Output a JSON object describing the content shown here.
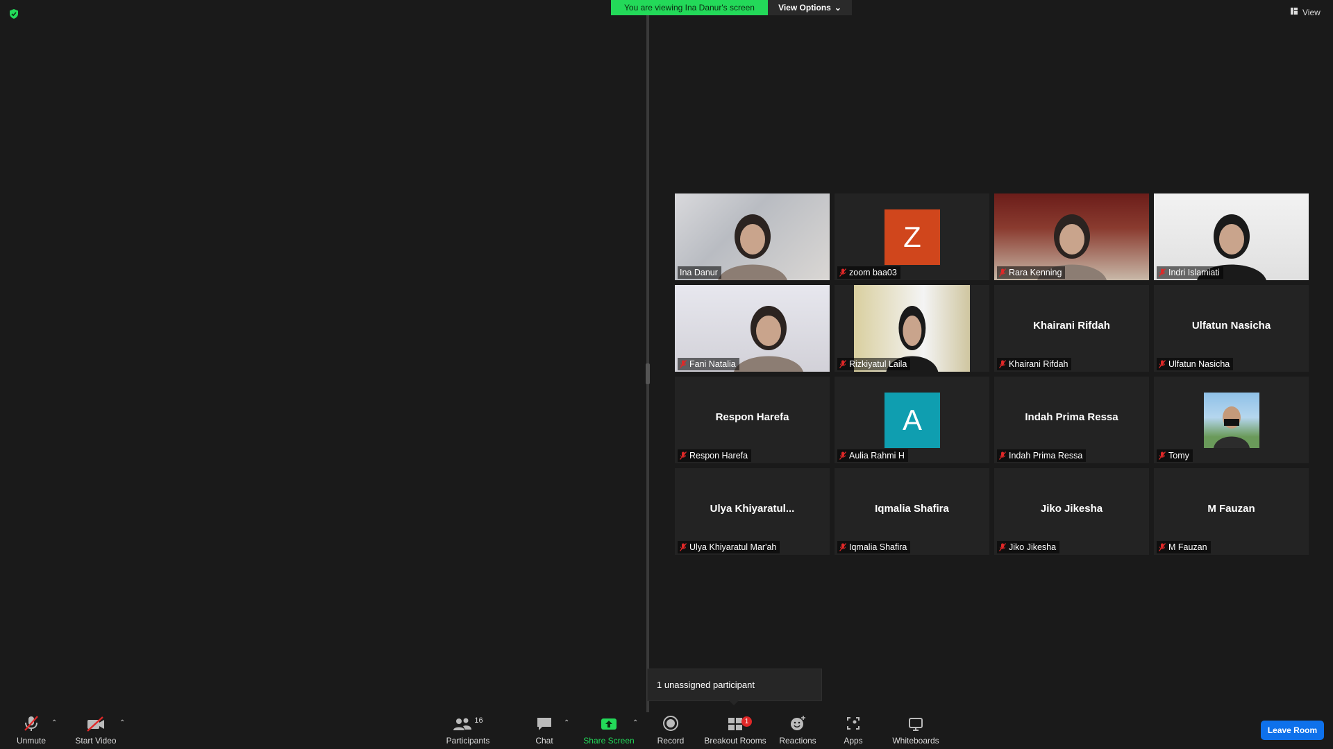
{
  "banner": {
    "text": "You are viewing Ina Danur's screen",
    "color": "#23d959"
  },
  "view_options": {
    "label": "View Options"
  },
  "view_button": {
    "label": "View"
  },
  "tooltip": {
    "text": "1 unassigned participant"
  },
  "participants": [
    {
      "label": "Ina Danur",
      "type": "video",
      "active": true
    },
    {
      "label": "zoom baa03",
      "type": "avatar",
      "letter": "Z",
      "color": "#d0461c"
    },
    {
      "label": "Rara Kenning",
      "type": "video"
    },
    {
      "label": "Indri Islamiati",
      "type": "video"
    },
    {
      "label": "Fani Natalia",
      "type": "video"
    },
    {
      "label": "Rizkiyatul Laila",
      "type": "video"
    },
    {
      "label": "Khairani Rifdah",
      "type": "name",
      "center": "Khairani Rifdah"
    },
    {
      "label": "Ulfatun Nasicha",
      "type": "name",
      "center": "Ulfatun Nasicha"
    },
    {
      "label": "Respon Harefa",
      "type": "name",
      "center": "Respon Harefa"
    },
    {
      "label": "Aulia Rahmi H",
      "type": "avatar",
      "letter": "A",
      "color": "#0f9eb0"
    },
    {
      "label": "Indah Prima Ressa",
      "type": "name",
      "center": "Indah Prima Ressa"
    },
    {
      "label": "Tomy",
      "type": "photo"
    },
    {
      "label": "Ulya Khiyaratul Mar'ah",
      "type": "name",
      "center": "Ulya  Khiyaratul..."
    },
    {
      "label": "Iqmalia Shafira",
      "type": "name",
      "center": "Iqmalia Shafira"
    },
    {
      "label": "Jiko Jikesha",
      "type": "name",
      "center": "Jiko Jikesha"
    },
    {
      "label": "M Fauzan",
      "type": "name",
      "center": "M Fauzan"
    }
  ],
  "toolbar": {
    "unmute": "Unmute",
    "start_video": "Start Video",
    "participants": "Participants",
    "participants_count": "16",
    "chat": "Chat",
    "share_screen": "Share Screen",
    "record": "Record",
    "breakout_rooms": "Breakout Rooms",
    "breakout_badge": "1",
    "reactions": "Reactions",
    "apps": "Apps",
    "whiteboards": "Whiteboards",
    "leave_room": "Leave Room"
  },
  "colors": {
    "share_green": "#23d959",
    "leave_blue": "#0e71eb",
    "active_outline": "#c6e94b"
  }
}
